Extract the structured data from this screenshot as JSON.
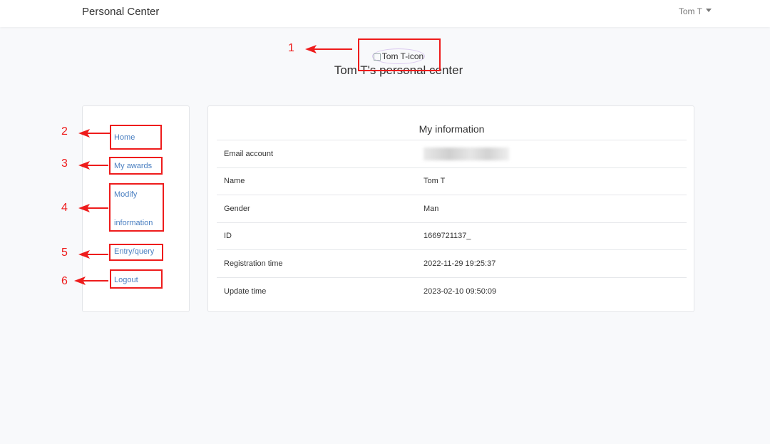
{
  "header": {
    "brand": "Personal Center",
    "user": "Tom T"
  },
  "profile": {
    "avatar_alt": "Tom T-icon",
    "title": "Tom T's personal center"
  },
  "sidebar": {
    "items": [
      {
        "label": "Home"
      },
      {
        "label": "My awards"
      },
      {
        "label_line1": "Modify",
        "label_line2": "information"
      },
      {
        "label": "Entry/query"
      },
      {
        "label": "Logout"
      }
    ]
  },
  "info": {
    "title": "My information",
    "rows": [
      {
        "label": "Email account",
        "value": ""
      },
      {
        "label": "Name",
        "value": "Tom T"
      },
      {
        "label": "Gender",
        "value": "Man"
      },
      {
        "label": "ID",
        "value": "1669721137_"
      },
      {
        "label": "Registration time",
        "value": "2022-11-29 19:25:37"
      },
      {
        "label": "Update time",
        "value": "2023-02-10 09:50:09"
      }
    ]
  },
  "annotations": {
    "numbers": [
      "1",
      "2",
      "3",
      "4",
      "5",
      "6"
    ],
    "color": "#ee1c1c"
  },
  "colors": {
    "link": "#4a7fc1",
    "background": "#f8f9fb"
  }
}
